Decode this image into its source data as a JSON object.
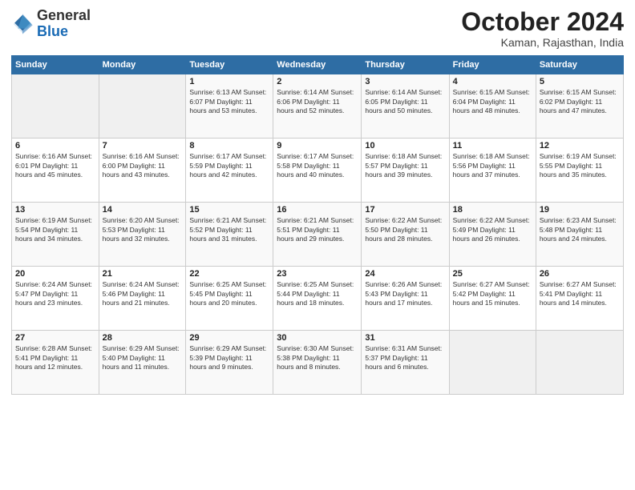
{
  "header": {
    "logo_general": "General",
    "logo_blue": "Blue",
    "month_title": "October 2024",
    "location": "Kaman, Rajasthan, India"
  },
  "weekdays": [
    "Sunday",
    "Monday",
    "Tuesday",
    "Wednesday",
    "Thursday",
    "Friday",
    "Saturday"
  ],
  "weeks": [
    [
      {
        "day": "",
        "info": ""
      },
      {
        "day": "",
        "info": ""
      },
      {
        "day": "1",
        "info": "Sunrise: 6:13 AM\nSunset: 6:07 PM\nDaylight: 11 hours and 53 minutes."
      },
      {
        "day": "2",
        "info": "Sunrise: 6:14 AM\nSunset: 6:06 PM\nDaylight: 11 hours and 52 minutes."
      },
      {
        "day": "3",
        "info": "Sunrise: 6:14 AM\nSunset: 6:05 PM\nDaylight: 11 hours and 50 minutes."
      },
      {
        "day": "4",
        "info": "Sunrise: 6:15 AM\nSunset: 6:04 PM\nDaylight: 11 hours and 48 minutes."
      },
      {
        "day": "5",
        "info": "Sunrise: 6:15 AM\nSunset: 6:02 PM\nDaylight: 11 hours and 47 minutes."
      }
    ],
    [
      {
        "day": "6",
        "info": "Sunrise: 6:16 AM\nSunset: 6:01 PM\nDaylight: 11 hours and 45 minutes."
      },
      {
        "day": "7",
        "info": "Sunrise: 6:16 AM\nSunset: 6:00 PM\nDaylight: 11 hours and 43 minutes."
      },
      {
        "day": "8",
        "info": "Sunrise: 6:17 AM\nSunset: 5:59 PM\nDaylight: 11 hours and 42 minutes."
      },
      {
        "day": "9",
        "info": "Sunrise: 6:17 AM\nSunset: 5:58 PM\nDaylight: 11 hours and 40 minutes."
      },
      {
        "day": "10",
        "info": "Sunrise: 6:18 AM\nSunset: 5:57 PM\nDaylight: 11 hours and 39 minutes."
      },
      {
        "day": "11",
        "info": "Sunrise: 6:18 AM\nSunset: 5:56 PM\nDaylight: 11 hours and 37 minutes."
      },
      {
        "day": "12",
        "info": "Sunrise: 6:19 AM\nSunset: 5:55 PM\nDaylight: 11 hours and 35 minutes."
      }
    ],
    [
      {
        "day": "13",
        "info": "Sunrise: 6:19 AM\nSunset: 5:54 PM\nDaylight: 11 hours and 34 minutes."
      },
      {
        "day": "14",
        "info": "Sunrise: 6:20 AM\nSunset: 5:53 PM\nDaylight: 11 hours and 32 minutes."
      },
      {
        "day": "15",
        "info": "Sunrise: 6:21 AM\nSunset: 5:52 PM\nDaylight: 11 hours and 31 minutes."
      },
      {
        "day": "16",
        "info": "Sunrise: 6:21 AM\nSunset: 5:51 PM\nDaylight: 11 hours and 29 minutes."
      },
      {
        "day": "17",
        "info": "Sunrise: 6:22 AM\nSunset: 5:50 PM\nDaylight: 11 hours and 28 minutes."
      },
      {
        "day": "18",
        "info": "Sunrise: 6:22 AM\nSunset: 5:49 PM\nDaylight: 11 hours and 26 minutes."
      },
      {
        "day": "19",
        "info": "Sunrise: 6:23 AM\nSunset: 5:48 PM\nDaylight: 11 hours and 24 minutes."
      }
    ],
    [
      {
        "day": "20",
        "info": "Sunrise: 6:24 AM\nSunset: 5:47 PM\nDaylight: 11 hours and 23 minutes."
      },
      {
        "day": "21",
        "info": "Sunrise: 6:24 AM\nSunset: 5:46 PM\nDaylight: 11 hours and 21 minutes."
      },
      {
        "day": "22",
        "info": "Sunrise: 6:25 AM\nSunset: 5:45 PM\nDaylight: 11 hours and 20 minutes."
      },
      {
        "day": "23",
        "info": "Sunrise: 6:25 AM\nSunset: 5:44 PM\nDaylight: 11 hours and 18 minutes."
      },
      {
        "day": "24",
        "info": "Sunrise: 6:26 AM\nSunset: 5:43 PM\nDaylight: 11 hours and 17 minutes."
      },
      {
        "day": "25",
        "info": "Sunrise: 6:27 AM\nSunset: 5:42 PM\nDaylight: 11 hours and 15 minutes."
      },
      {
        "day": "26",
        "info": "Sunrise: 6:27 AM\nSunset: 5:41 PM\nDaylight: 11 hours and 14 minutes."
      }
    ],
    [
      {
        "day": "27",
        "info": "Sunrise: 6:28 AM\nSunset: 5:41 PM\nDaylight: 11 hours and 12 minutes."
      },
      {
        "day": "28",
        "info": "Sunrise: 6:29 AM\nSunset: 5:40 PM\nDaylight: 11 hours and 11 minutes."
      },
      {
        "day": "29",
        "info": "Sunrise: 6:29 AM\nSunset: 5:39 PM\nDaylight: 11 hours and 9 minutes."
      },
      {
        "day": "30",
        "info": "Sunrise: 6:30 AM\nSunset: 5:38 PM\nDaylight: 11 hours and 8 minutes."
      },
      {
        "day": "31",
        "info": "Sunrise: 6:31 AM\nSunset: 5:37 PM\nDaylight: 11 hours and 6 minutes."
      },
      {
        "day": "",
        "info": ""
      },
      {
        "day": "",
        "info": ""
      }
    ]
  ]
}
